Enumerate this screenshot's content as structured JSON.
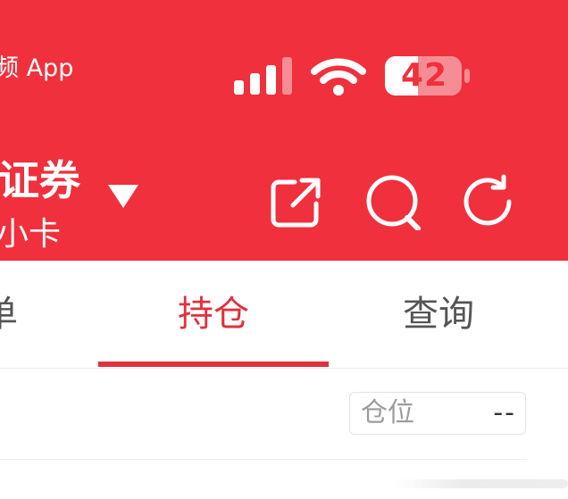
{
  "status_bar": {
    "back_app": "频 App",
    "battery": "42"
  },
  "header": {
    "account_name": "证券",
    "account_sub": "小卡"
  },
  "icons": {
    "share": "share-icon",
    "search": "search-icon",
    "refresh": "refresh-icon",
    "dropdown": "triangle-down-icon"
  },
  "tabs": [
    {
      "label": "单",
      "active": false
    },
    {
      "label": "持仓",
      "active": true
    },
    {
      "label": "查询",
      "active": false
    }
  ],
  "position": {
    "label": "仓位",
    "value": "--"
  },
  "colors": {
    "header_bg": "#f0303d",
    "accent": "#e0313c",
    "text_gray": "#555555"
  }
}
